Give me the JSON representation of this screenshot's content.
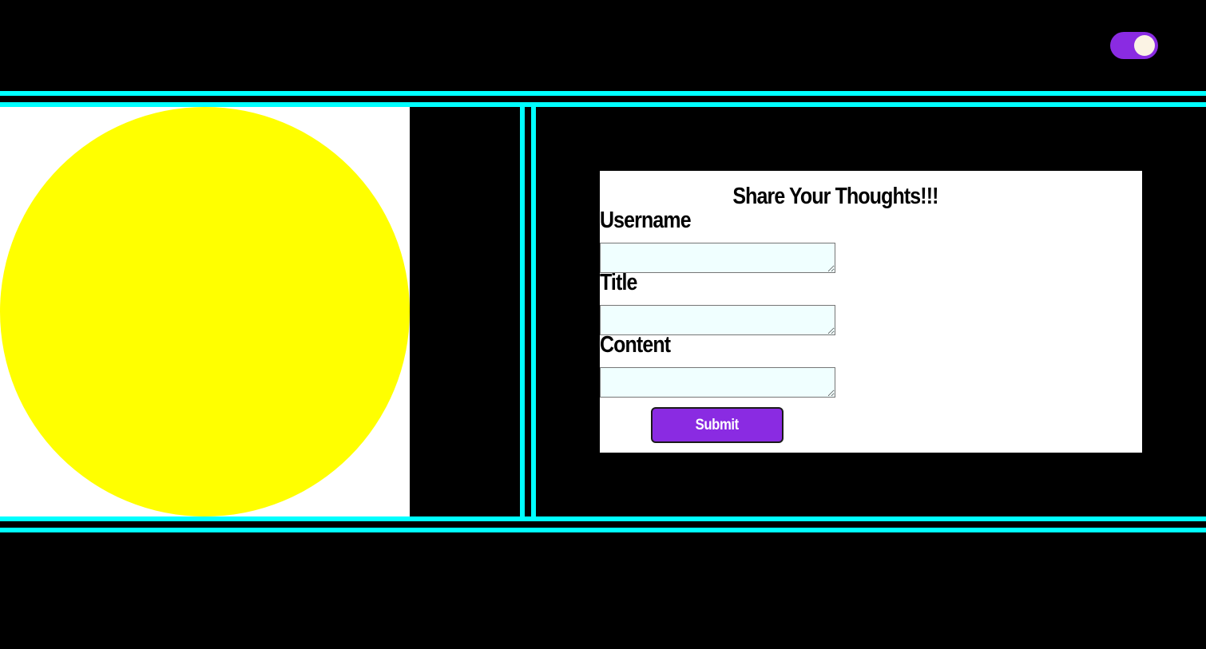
{
  "colors": {
    "background": "#000000",
    "accent_lines": "#00ffff",
    "toggle": "#8a2be2",
    "toggle_knob": "#fbf3e4",
    "sun": "#ffff00",
    "button": "#8a2be2",
    "input_background": "#f0ffff"
  },
  "header": {
    "theme_toggle": {
      "state": "on",
      "icon": "toggle-switch"
    }
  },
  "illustration": {
    "icon": "sun-circle"
  },
  "form": {
    "title": "Share Your Thoughts!!!",
    "fields": [
      {
        "label": "Username",
        "value": ""
      },
      {
        "label": "Title",
        "value": ""
      },
      {
        "label": "Content",
        "value": ""
      }
    ],
    "submit_label": "Submit"
  }
}
